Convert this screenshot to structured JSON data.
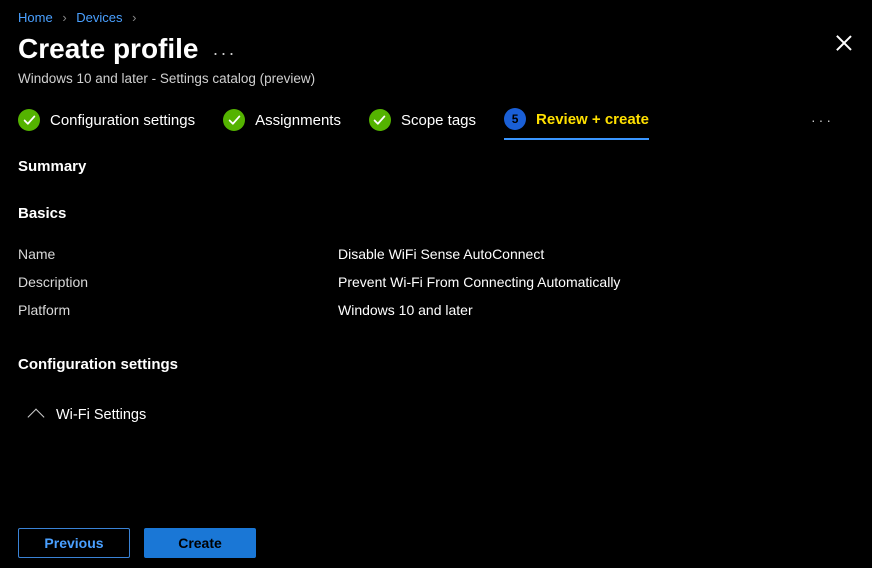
{
  "breadcrumb": {
    "home": "Home",
    "devices": "Devices"
  },
  "header": {
    "title": "Create profile",
    "subtitle": "Windows 10 and later - Settings catalog (preview)"
  },
  "steps": {
    "s1": "Configuration settings",
    "s2": "Assignments",
    "s3": "Scope tags",
    "s4_num": "5",
    "s4": "Review + create"
  },
  "summary": {
    "heading": "Summary"
  },
  "basics": {
    "heading": "Basics",
    "rows": {
      "name_label": "Name",
      "name_value": "Disable WiFi Sense AutoConnect",
      "desc_label": "Description",
      "desc_value": "Prevent Wi-Fi From Connecting Automatically",
      "platform_label": "Platform",
      "platform_value": "Windows 10 and later"
    }
  },
  "config": {
    "heading": "Configuration settings",
    "group1": "Wi-Fi Settings"
  },
  "footer": {
    "previous": "Previous",
    "create": "Create"
  }
}
